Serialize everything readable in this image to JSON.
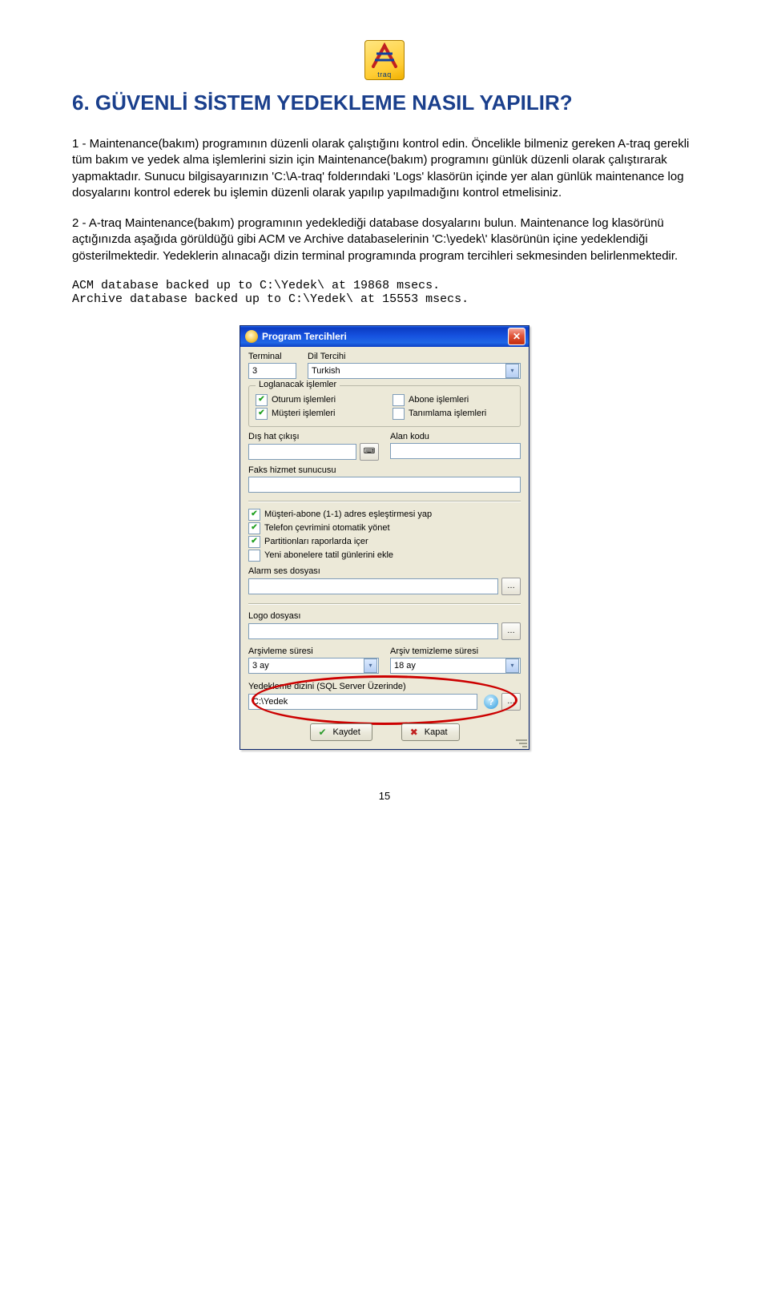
{
  "logo_text": "traq",
  "heading": "6. GÜVENLİ SİSTEM YEDEKLEME NASIL YAPILIR?",
  "para1": "1 - Maintenance(bakım) programının düzenli olarak çalıştığını kontrol edin. Öncelikle bilmeniz gereken A-traq gerekli tüm bakım ve yedek alma işlemlerini sizin için Maintenance(bakım) programını günlük düzenli olarak çalıştırarak yapmaktadır. Sunucu bilgisayarınızın 'C:\\A-traq' folderındaki 'Logs' klasörün içinde yer alan günlük maintenance log dosyalarını kontrol ederek bu işlemin düzenli olarak yapılıp yapılmadığını kontrol etmelisiniz.",
  "para2": "2 - A-traq Maintenance(bakım) programının yedeklediği database dosyalarını bulun. Maintenance log klasörünü açtığınızda aşağıda görüldüğü gibi ACM ve Archive databaselerinin 'C:\\yedek\\' klasörünün içine yedeklendiği gösterilmektedir. Yedeklerin alınacağı dizin terminal programında program tercihleri sekmesinden belirlenmektedir.",
  "mono": "ACM database backed up to C:\\Yedek\\ at 19868 msecs.\nArchive database backed up to C:\\Yedek\\ at 15553 msecs.",
  "dialog": {
    "title": "Program Tercihleri",
    "terminal_label": "Terminal",
    "terminal_value": "3",
    "lang_label": "Dil Tercihi",
    "lang_value": "Turkish",
    "log_group": "Loglanacak işlemler",
    "chk_session": "Oturum işlemleri",
    "chk_subscriber": "Abone işlemleri",
    "chk_customer": "Müşteri işlemleri",
    "chk_definition": "Tanımlama işlemleri",
    "out_label": "Dış hat çıkışı",
    "area_label": "Alan kodu",
    "fax_label": "Faks hizmet sunucusu",
    "opt1": "Müşteri-abone (1-1) adres eşleştirmesi yap",
    "opt2": "Telefon çevrimini otomatik yönet",
    "opt3": "Partitionları raporlarda içer",
    "opt4": "Yeni abonelere tatil günlerini ekle",
    "alarm_label": "Alarm ses dosyası",
    "logo_label": "Logo dosyası",
    "arch_dur_label": "Arşivleme süresi",
    "arch_dur_value": "3 ay",
    "arch_clean_label": "Arşiv temizleme süresi",
    "arch_clean_value": "18 ay",
    "backup_label": "Yedekleme dizini (SQL Server Üzerinde)",
    "backup_value": "C:\\Yedek",
    "save_btn": "Kaydet",
    "close_btn": "Kapat"
  },
  "page_number": "15"
}
